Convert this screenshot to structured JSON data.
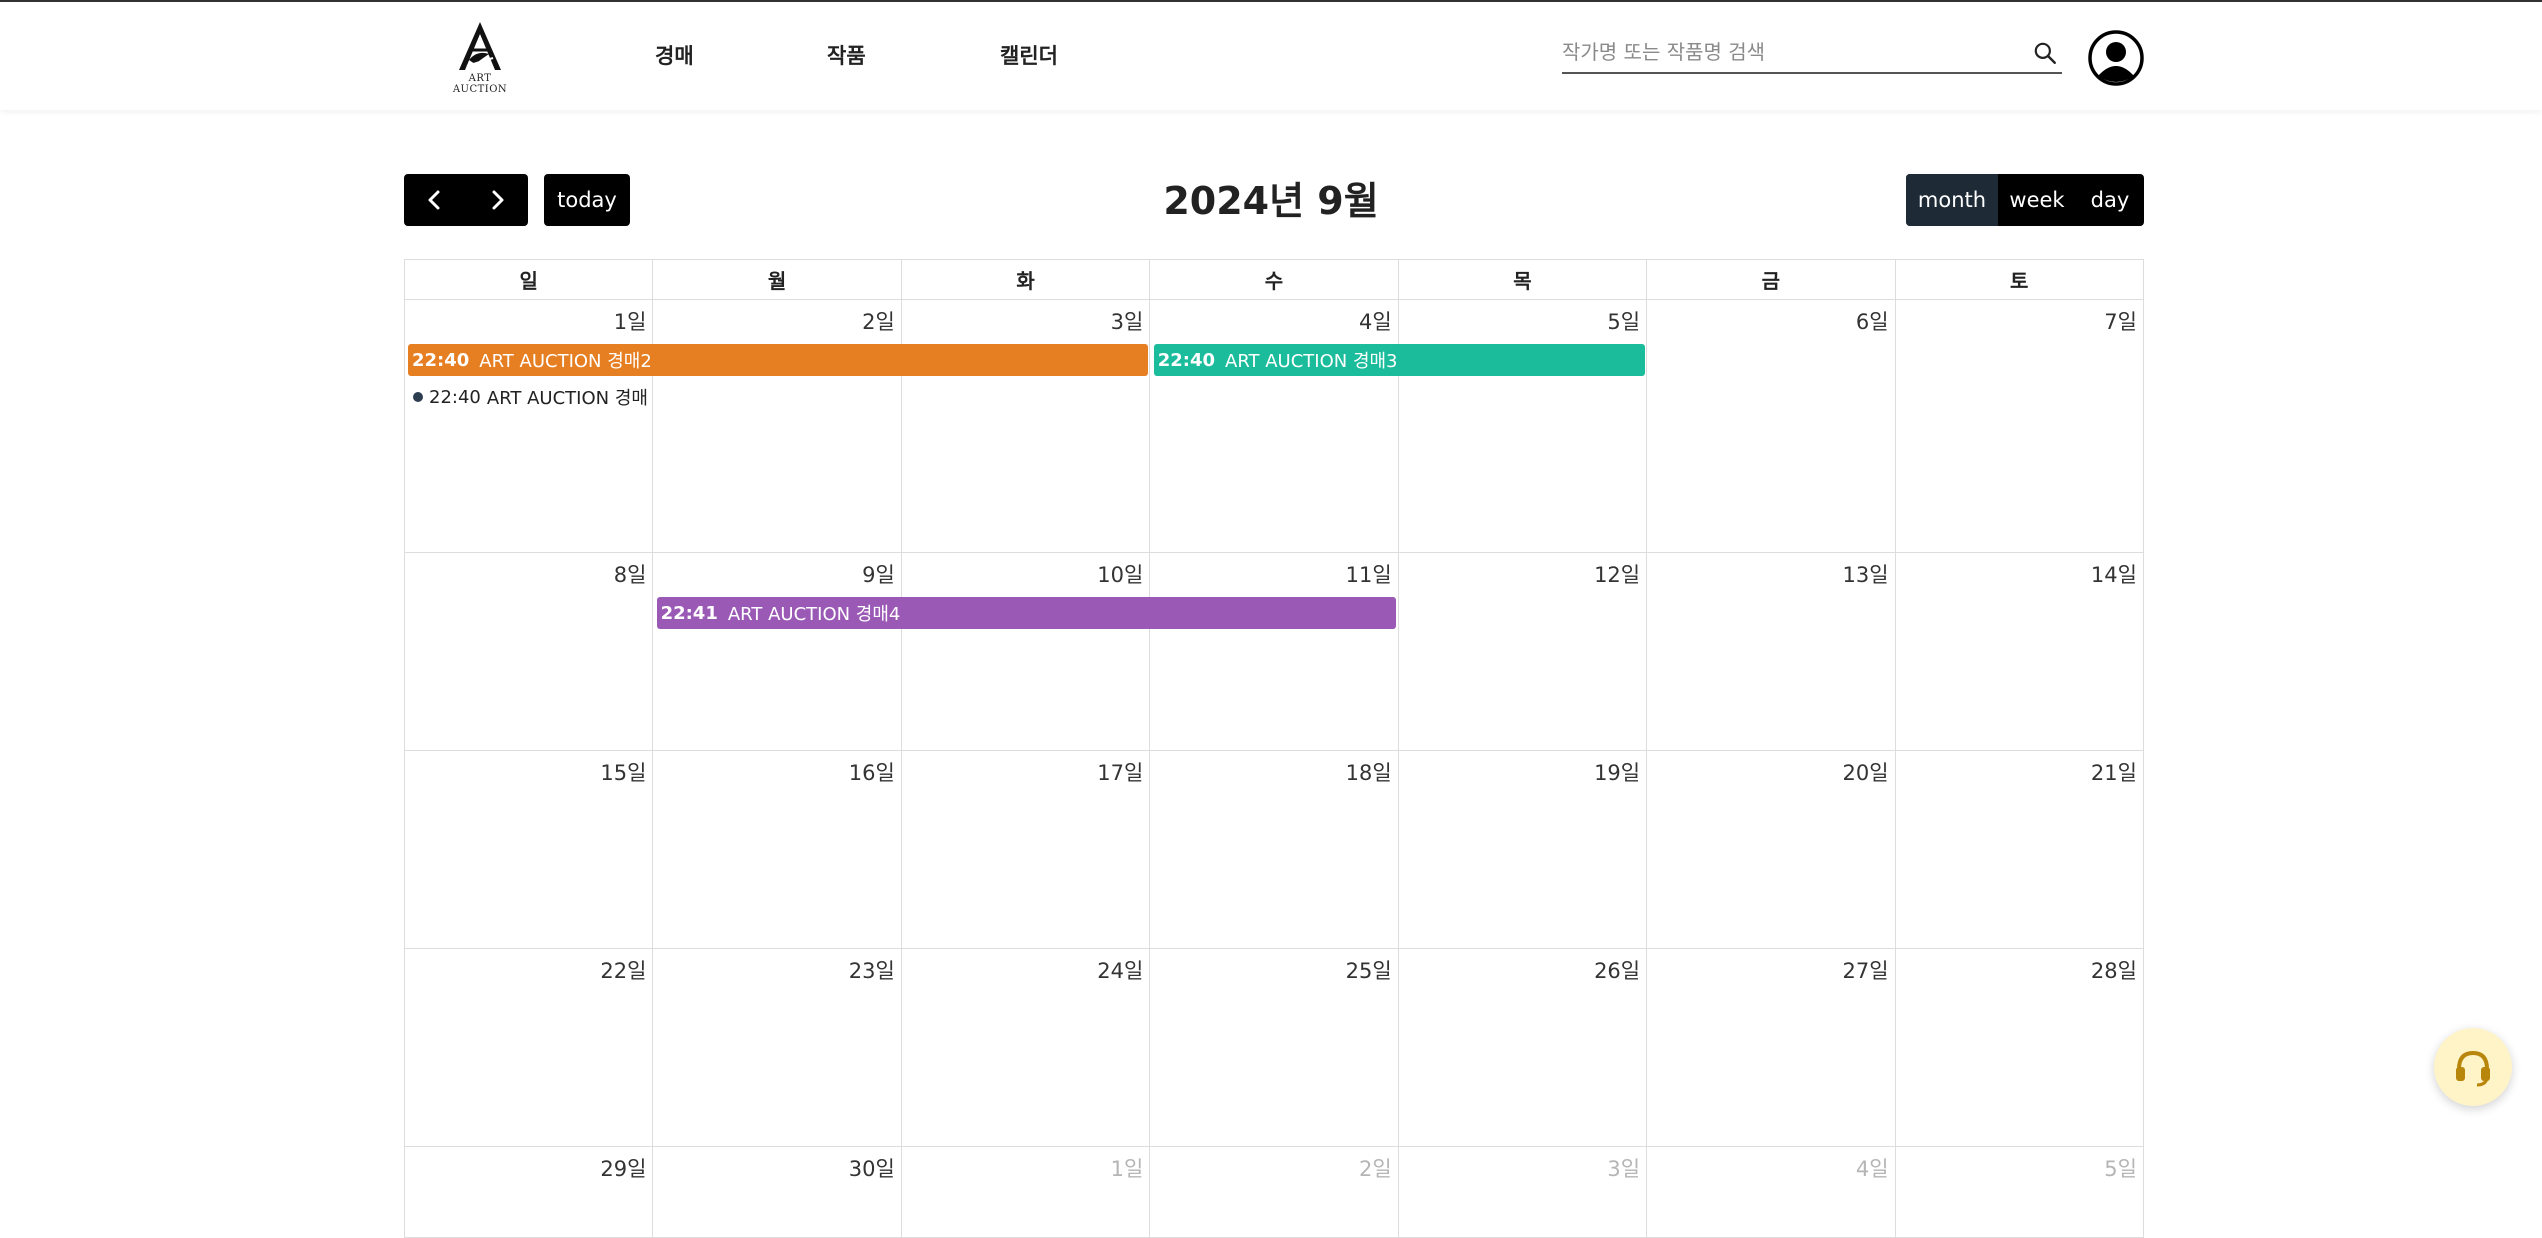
{
  "header": {
    "logo_text": "ART AUCTION",
    "nav": [
      "경매",
      "작품",
      "캘린더"
    ],
    "search_placeholder": "작가명 또는 작품명 검색",
    "search_value": ""
  },
  "toolbar": {
    "prev_icon": "chevron-left-icon",
    "next_icon": "chevron-right-icon",
    "today_label": "today",
    "title": "2024년 9월",
    "views": [
      "month",
      "week",
      "day"
    ],
    "active_view": "month"
  },
  "calendar": {
    "weekdays": [
      "일",
      "월",
      "화",
      "수",
      "목",
      "금",
      "토"
    ],
    "weeks": [
      [
        {
          "d": "1일",
          "o": false
        },
        {
          "d": "2일",
          "o": false
        },
        {
          "d": "3일",
          "o": false
        },
        {
          "d": "4일",
          "o": false
        },
        {
          "d": "5일",
          "o": false
        },
        {
          "d": "6일",
          "o": false
        },
        {
          "d": "7일",
          "o": false
        }
      ],
      [
        {
          "d": "8일",
          "o": false
        },
        {
          "d": "9일",
          "o": false
        },
        {
          "d": "10일",
          "o": false
        },
        {
          "d": "11일",
          "o": false
        },
        {
          "d": "12일",
          "o": false
        },
        {
          "d": "13일",
          "o": false
        },
        {
          "d": "14일",
          "o": false
        }
      ],
      [
        {
          "d": "15일",
          "o": false
        },
        {
          "d": "16일",
          "o": false
        },
        {
          "d": "17일",
          "o": false
        },
        {
          "d": "18일",
          "o": false
        },
        {
          "d": "19일",
          "o": false
        },
        {
          "d": "20일",
          "o": false
        },
        {
          "d": "21일",
          "o": false
        }
      ],
      [
        {
          "d": "22일",
          "o": false
        },
        {
          "d": "23일",
          "o": false
        },
        {
          "d": "24일",
          "o": false
        },
        {
          "d": "25일",
          "o": false
        },
        {
          "d": "26일",
          "o": false
        },
        {
          "d": "27일",
          "o": false
        },
        {
          "d": "28일",
          "o": false
        }
      ],
      [
        {
          "d": "29일",
          "o": false
        },
        {
          "d": "30일",
          "o": false
        },
        {
          "d": "1일",
          "o": true
        },
        {
          "d": "2일",
          "o": true
        },
        {
          "d": "3일",
          "o": true
        },
        {
          "d": "4일",
          "o": true
        },
        {
          "d": "5일",
          "o": true
        }
      ]
    ],
    "events": [
      {
        "time": "22:40",
        "title": "ART AUCTION 경매2",
        "week": 0,
        "start": 0,
        "span": 3,
        "color": "#e67e22",
        "kind": "bar"
      },
      {
        "time": "22:40",
        "title": "ART AUCTION 경매3",
        "week": 0,
        "start": 3,
        "span": 2,
        "color": "#1abc9c",
        "kind": "bar"
      },
      {
        "time": "22:40",
        "title": "ART AUCTION 경매",
        "week": 0,
        "start": 0,
        "span": 1,
        "color": "#2c3e50",
        "kind": "dot"
      },
      {
        "time": "22:41",
        "title": "ART AUCTION 경매4",
        "week": 1,
        "start": 1,
        "span": 3,
        "color": "#9b59b6",
        "kind": "bar"
      }
    ]
  },
  "support_icon": "headset-icon"
}
